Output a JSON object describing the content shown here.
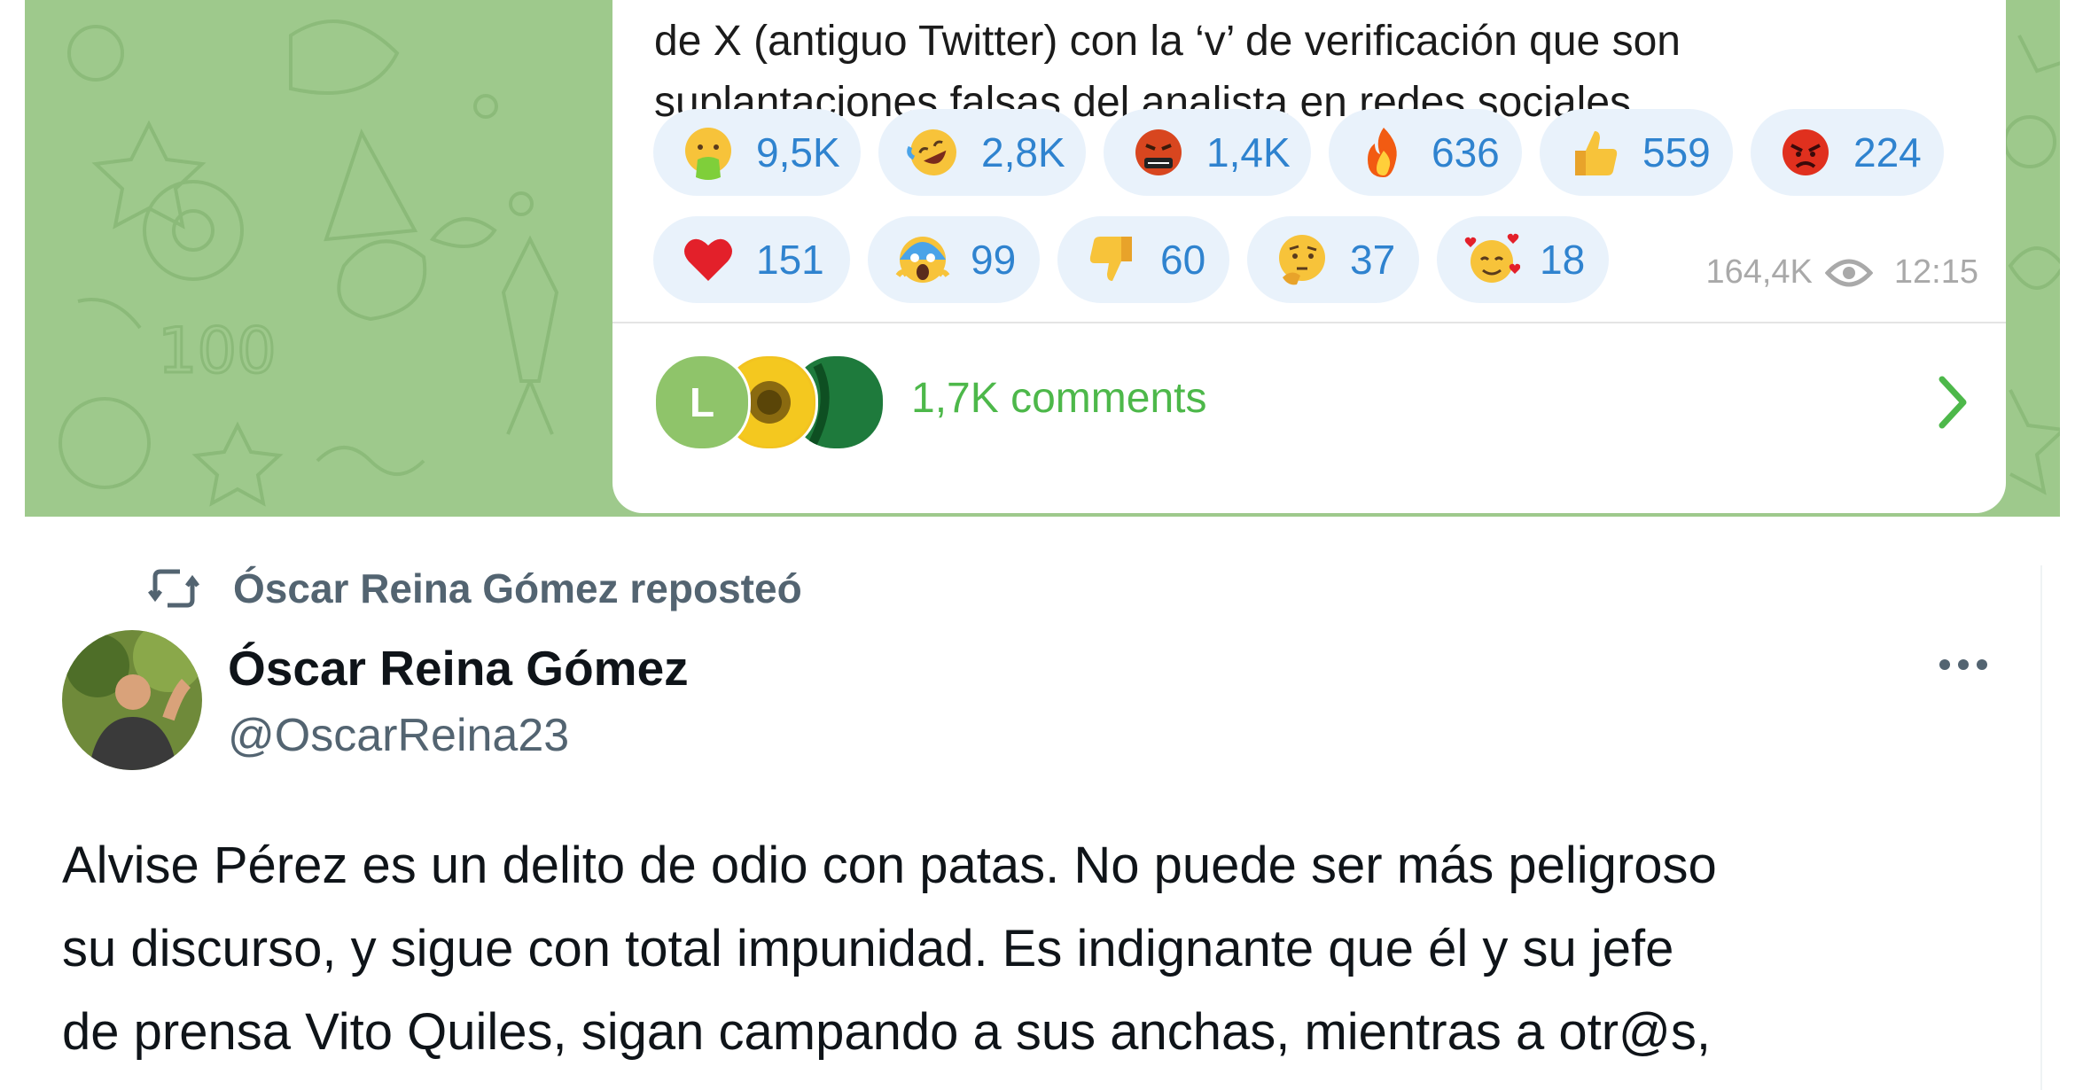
{
  "telegram": {
    "message_lines": [
      "de X (antiguo Twitter) con la ‘v’ de verificación que son",
      "suplantaciones falsas del analista en redes sociales."
    ],
    "reactions": [
      {
        "emoji": "nauseated-face",
        "count": "9,5K"
      },
      {
        "emoji": "rofl-face",
        "count": "2,8K"
      },
      {
        "emoji": "cursing-face",
        "count": "1,4K"
      },
      {
        "emoji": "fire",
        "count": "636"
      },
      {
        "emoji": "thumbs-up",
        "count": "559"
      },
      {
        "emoji": "angry-face",
        "count": "224"
      },
      {
        "emoji": "red-heart",
        "count": "151"
      },
      {
        "emoji": "screaming-face",
        "count": "99"
      },
      {
        "emoji": "thumbs-down",
        "count": "60"
      },
      {
        "emoji": "thinking-face",
        "count": "37"
      },
      {
        "emoji": "smiling-face-with-hearts",
        "count": "18"
      }
    ],
    "views": "164,4K",
    "time": "12:15",
    "comments_label": "1,7K comments",
    "commenter_initial": "L",
    "colors": {
      "chat_background": "#9ec98c",
      "reaction_pill": "#e9f2fb",
      "reaction_count": "#2f83cf",
      "comments_accent": "#4db84a"
    }
  },
  "x_post": {
    "repost_label": "Óscar Reina Gómez reposteó",
    "author_name": "Óscar Reina Gómez",
    "author_handle": "@OscarReina23",
    "body_lines": [
      "Alvise Pérez es un delito de odio con patas. No puede ser más peligroso",
      "su discurso, y sigue con total impunidad. Es indignante que él y su jefe",
      "de prensa Vito Quiles, sigan campando a sus anchas, mientras a otr@s,"
    ],
    "colors": {
      "text_primary": "#0f1419",
      "text_secondary": "#536471"
    }
  }
}
